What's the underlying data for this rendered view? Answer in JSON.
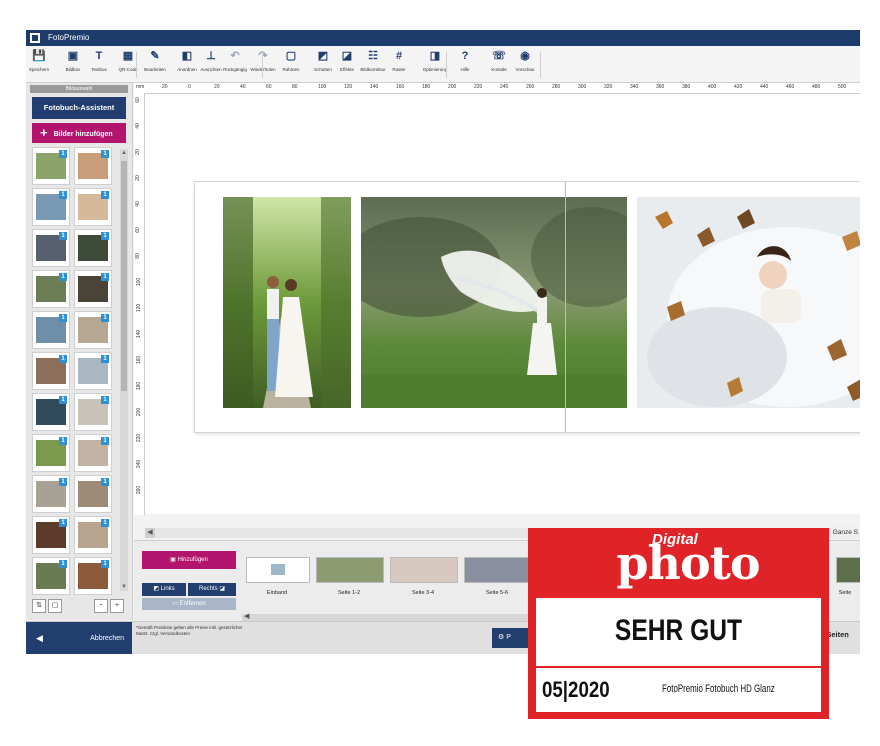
{
  "window": {
    "title": "FotoPremio"
  },
  "toolbar": {
    "items": [
      {
        "label": "Speichern",
        "icon": "save-icon"
      },
      {
        "label": "Bildbox",
        "icon": "image-box-icon"
      },
      {
        "label": "Textbox",
        "icon": "textbox-icon"
      },
      {
        "label": "QR-Code",
        "icon": "qr-code-icon"
      },
      {
        "label": "Bearbeiten",
        "icon": "edit-icon"
      },
      {
        "label": "Anordnen",
        "icon": "arrange-icon"
      },
      {
        "label": "Ausrichten",
        "icon": "align-icon"
      },
      {
        "label": "Rückgängig",
        "icon": "undo-icon"
      },
      {
        "label": "Wiederholen",
        "icon": "redo-icon"
      },
      {
        "label": "Rahmen",
        "icon": "frame-icon"
      },
      {
        "label": "Schatten",
        "icon": "shadow-icon"
      },
      {
        "label": "Effekte",
        "icon": "effects-icon"
      },
      {
        "label": "Bildkorrektur",
        "icon": "image-correction-icon"
      },
      {
        "label": "Raster",
        "icon": "grid-icon"
      },
      {
        "label": "Optimierung",
        "icon": "optimize-icon"
      },
      {
        "label": "Hilfe",
        "icon": "help-icon"
      },
      {
        "label": "Kontakt",
        "icon": "phone-icon"
      },
      {
        "label": "Vorschau",
        "icon": "preview-eye-icon"
      }
    ]
  },
  "sidebar": {
    "header": "Bildauswahl",
    "assistant_button": "Fotobuch-Assistent",
    "add_images_button": "Bilder hinzufügen",
    "thumb_badge": "1"
  },
  "ruler": {
    "unit": "mm",
    "h_ticks": [
      "20",
      "0",
      "20",
      "40",
      "60",
      "80",
      "100",
      "120",
      "140",
      "160",
      "180",
      "200",
      "220",
      "240",
      "260",
      "280",
      "300",
      "320",
      "340",
      "360",
      "380",
      "400",
      "420",
      "440",
      "460",
      "480",
      "500"
    ],
    "v_ticks": [
      "60",
      "40",
      "20",
      "20",
      "40",
      "60",
      "80",
      "100",
      "120",
      "140",
      "160",
      "180",
      "200",
      "220",
      "240",
      "260"
    ]
  },
  "canvas": {
    "zoom_label": "Ganze S"
  },
  "pagestrip": {
    "add_button": "Hinzufügen",
    "left_button": "Links",
    "right_button": "Rechts",
    "remove_button": "Entfernen",
    "pages": [
      "Einband",
      "Seite 1-2",
      "Seite 3-4",
      "Seite 5-6",
      "Seite"
    ]
  },
  "bottombar": {
    "cancel_button": "Abbrechen",
    "price_note": "*Gemäß Preisliste gelten alle Preise inkl. gesetzlicher MwSt. zzgl. Versandkosten",
    "p_button": "P",
    "page_count": "/6 Seiten"
  },
  "award": {
    "digital": "Digital",
    "magazine": "photo",
    "rating": "SEHR GUT",
    "issue_month": "05",
    "issue_year": "2020",
    "product": "FotoPremio Fotobuch HD Glanz"
  },
  "colors": {
    "navy": "#213e6e",
    "magenta": "#b2146e",
    "award_red": "#e02327",
    "badge_blue": "#2d8fd6"
  }
}
